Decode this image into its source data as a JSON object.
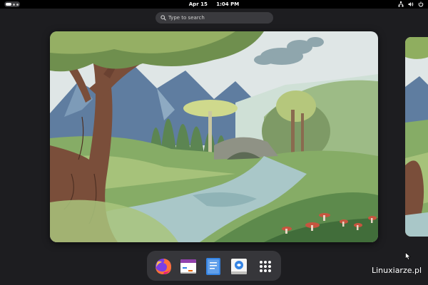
{
  "topbar": {
    "date": "Apr 15",
    "time": "1:04 PM"
  },
  "search": {
    "placeholder": "Type to search"
  },
  "dock": {
    "apps": [
      "firefox-icon",
      "calendar-icon",
      "text-editor-icon",
      "software-icon",
      "app-grid-icon"
    ]
  },
  "watermark": "Linuxiarze.pl",
  "colors": {
    "background": "#1d1d20",
    "topbar": "#000000",
    "dock": "#36363a",
    "search": "#3a3a3e"
  }
}
